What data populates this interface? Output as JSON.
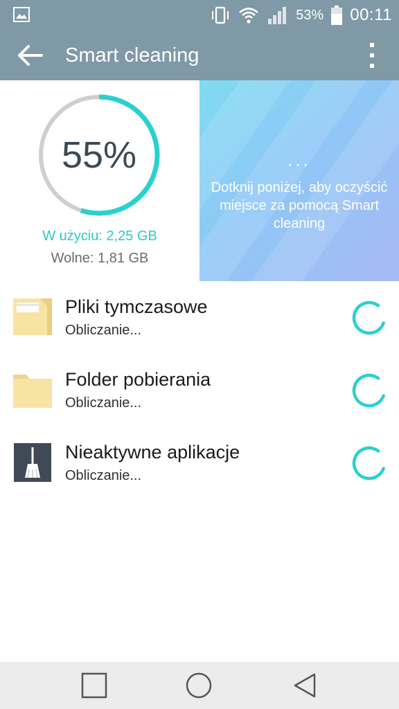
{
  "status_bar": {
    "battery_percent": "53%",
    "time": "00:11",
    "icons": [
      "image-icon",
      "vibrate-icon",
      "wifi-icon",
      "signal-icon",
      "battery-icon"
    ]
  },
  "app_bar": {
    "title": "Smart cleaning",
    "back_icon": "arrow-back-icon",
    "menu_icon": "more-vert-icon"
  },
  "storage": {
    "percent_label": "55%",
    "percent_value": 0.55,
    "used_label": "W użyciu: 2,25  GB",
    "free_label": "Wolne: 1,81  GB",
    "ring_color": "#2ad0cf",
    "track_color": "#cfcfcf"
  },
  "promo": {
    "dots": "...",
    "text": "Dotknij poniżej, aby oczyścić miejsce za pomocą Smart cleaning"
  },
  "items": [
    {
      "title": "Pliki tymczasowe",
      "subtitle": "Obliczanie...",
      "icon": "temp-files-folder-icon"
    },
    {
      "title": "Folder pobierania",
      "subtitle": "Obliczanie...",
      "icon": "downloads-folder-icon"
    },
    {
      "title": "Nieaktywne aplikacje",
      "subtitle": "Obliczanie...",
      "icon": "broom-icon"
    }
  ],
  "nav_bar": {
    "buttons": [
      "recents-button",
      "home-button",
      "back-button"
    ]
  },
  "colors": {
    "app_bar": "#7f99a6",
    "accent": "#2ad0cf"
  }
}
